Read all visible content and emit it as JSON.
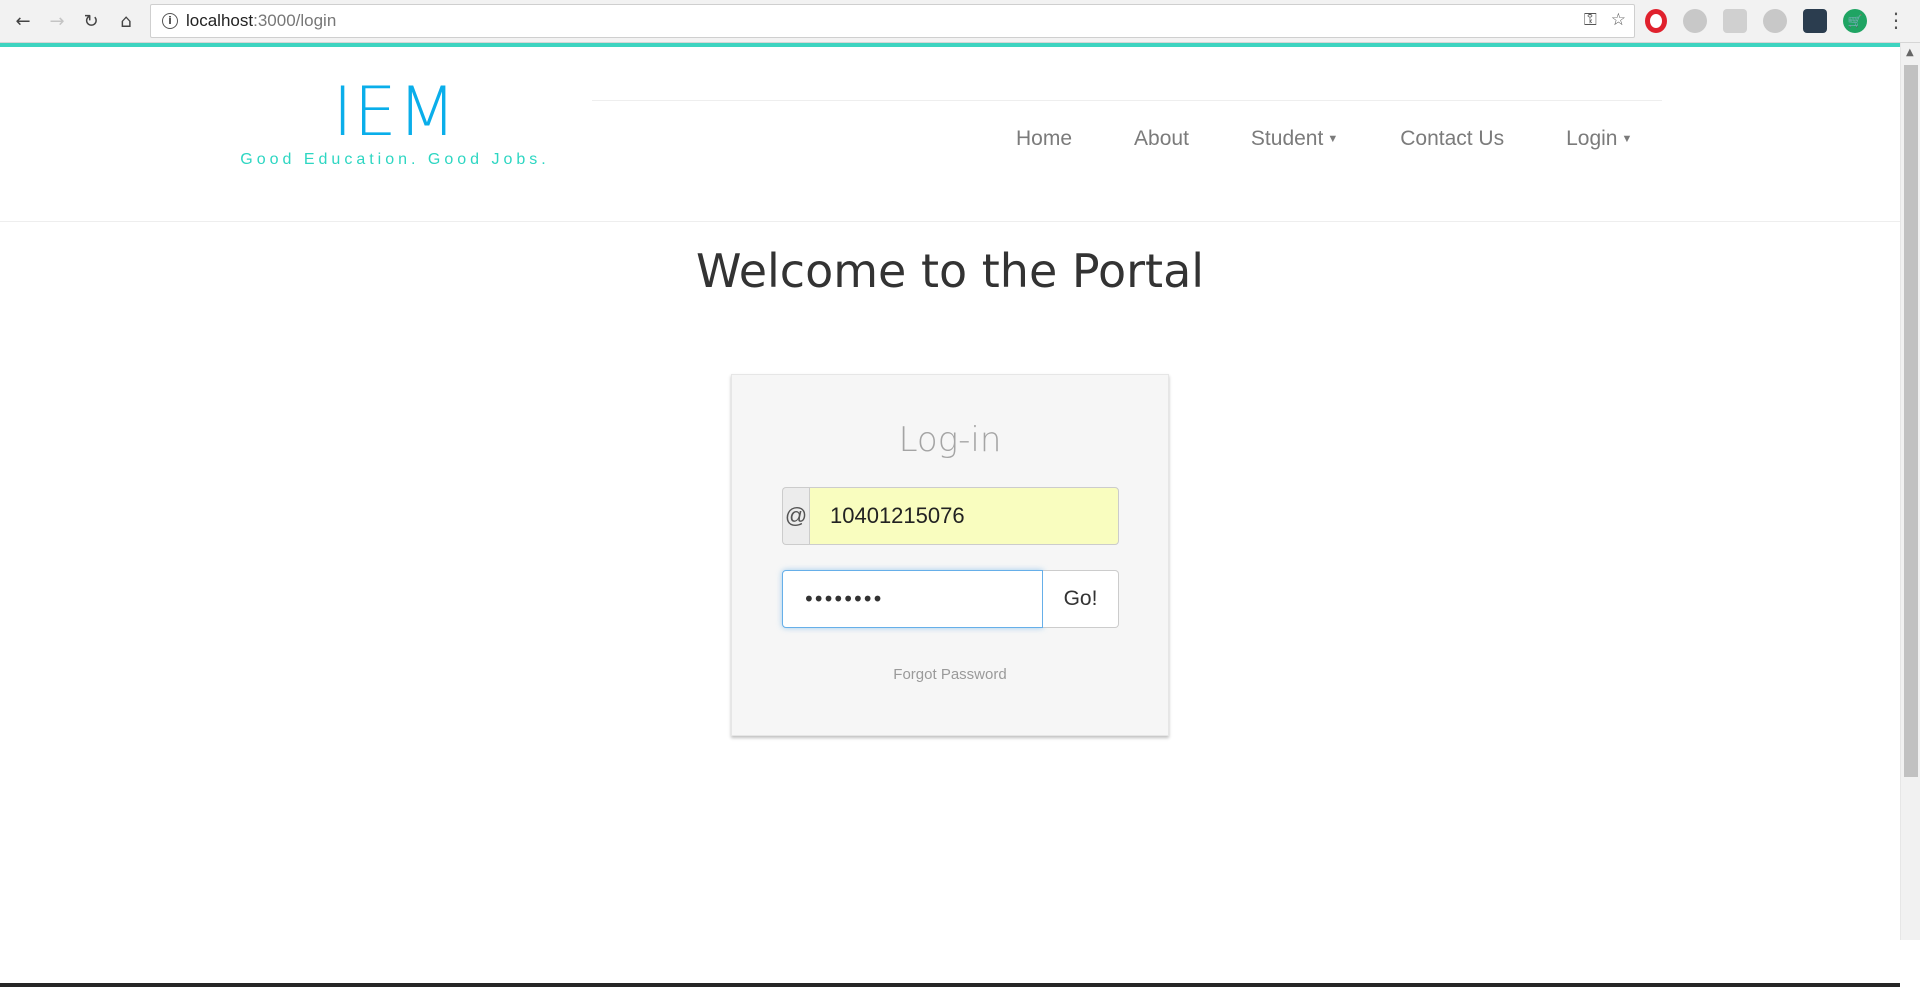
{
  "browser": {
    "url_host": "localhost",
    "url_path": ":3000/login",
    "icons": [
      "back-arrow-icon",
      "forward-arrow-icon",
      "reload-icon",
      "home-icon",
      "info-icon",
      "key-icon",
      "star-icon",
      "kebab-menu-icon"
    ],
    "back_glyph": "←",
    "forward_glyph": "→",
    "reload_glyph": "↻",
    "home_glyph": "⌂",
    "info_glyph": "i",
    "key_glyph": "⚿",
    "star_glyph": "☆",
    "menu_glyph": "⋮",
    "cart_glyph": "🛒"
  },
  "brand": {
    "title": "IEM",
    "tagline": "Good Education. Good Jobs.",
    "title_color": "#0aaeea",
    "tagline_color": "#2dd6c2",
    "accent": "#3ed4c0"
  },
  "nav": {
    "home": "Home",
    "about": "About",
    "student": "Student",
    "contact": "Contact Us",
    "login": "Login",
    "caret": "▼"
  },
  "main": {
    "heading": "Welcome to the Portal"
  },
  "login_form": {
    "title": "Log-in",
    "at_symbol": "@",
    "username_value": "10401215076",
    "password_value": "••••••••",
    "go_label": "Go!",
    "forgot_label": "Forgot Password"
  }
}
